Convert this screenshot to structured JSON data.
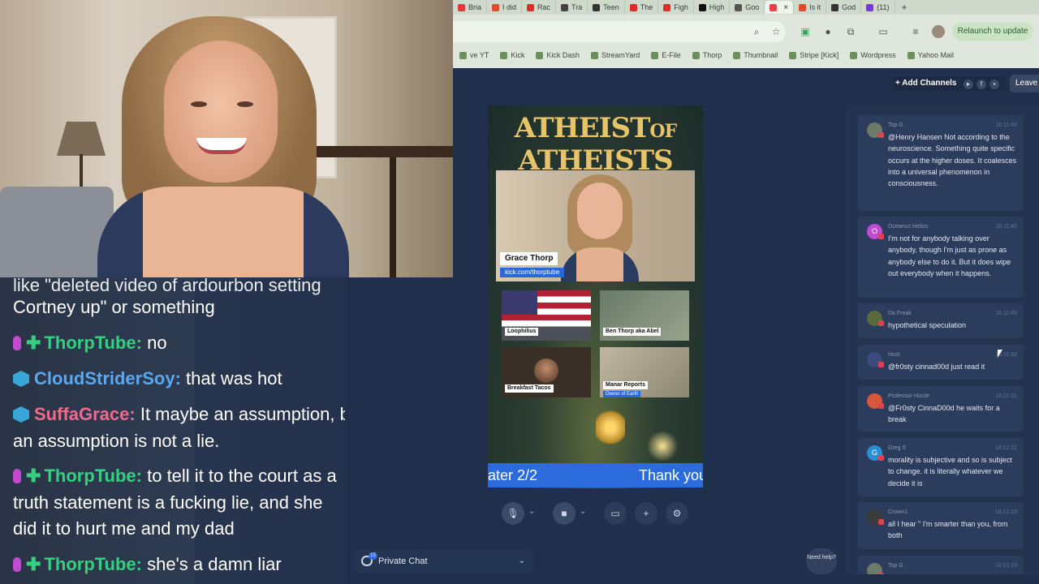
{
  "browser": {
    "tabs": [
      {
        "label": "Bria",
        "color": "#d93b3b"
      },
      {
        "label": "I did",
        "color": "#e34a2b"
      },
      {
        "label": "Rac",
        "color": "#e02b2b"
      },
      {
        "label": "Tra",
        "color": "#444444"
      },
      {
        "label": "Teen",
        "color": "#333333"
      },
      {
        "label": "The",
        "color": "#e02b2b"
      },
      {
        "label": "Figh",
        "color": "#e02b2b"
      },
      {
        "label": "High",
        "color": "#111111"
      },
      {
        "label": "Goo",
        "color": "#555555"
      },
      {
        "label": "",
        "color": "#e04646",
        "active": true
      },
      {
        "label": "Is it",
        "color": "#e34a2b"
      },
      {
        "label": "God",
        "color": "#333333"
      },
      {
        "label": "(11)",
        "color": "#7a3ad9"
      }
    ],
    "new_tab": "+",
    "relaunch_label": "Relaunch to update",
    "bookmarks": [
      "ve YT",
      "Kick",
      "Kick Dash",
      "StreamYard",
      "E-File",
      "Thorp",
      "Thumbnail",
      "Stripe [Kick]",
      "Wordpress",
      "Yahoo Mail"
    ]
  },
  "overlay_chat": {
    "lines": [
      {
        "type": "partial",
        "text": "like \"deleted video of ardourbon setting"
      },
      {
        "type": "cont",
        "text": "Cortney up\" or something"
      },
      {
        "type": "msg",
        "badge": "mod",
        "name": "ThorpTube:",
        "name_color": "#35d07f",
        "text": " no"
      },
      {
        "type": "msg",
        "badge": "cube",
        "name": "CloudStriderSoy:",
        "name_color": "#5aa8f0",
        "text": " that was hot"
      },
      {
        "type": "msg",
        "badge": "cube",
        "name": "SuffaGrace:",
        "name_color": "#f06a8a",
        "text": " It maybe an assumption, but"
      },
      {
        "type": "cont",
        "text": "an assumption is not a lie."
      },
      {
        "type": "msg",
        "badge": "mod",
        "name": "ThorpTube:",
        "name_color": "#35d07f",
        "text": " to tell it to the court as a"
      },
      {
        "type": "cont",
        "text": "truth statement is a fucking lie, and she"
      },
      {
        "type": "cont",
        "text": "did it to hurt me and my dad"
      },
      {
        "type": "msg",
        "badge": "mod",
        "name": "ThorpTube:",
        "name_color": "#35d07f",
        "text": " she's a damn liar"
      }
    ]
  },
  "studio": {
    "add_channels": "+ Add Channels",
    "leave": "Leave",
    "scene": {
      "title_line1_a": "ATHEIST",
      "title_line1_b": "OF",
      "title_line2": "ATHEISTS",
      "host_name": "Grace Thorp",
      "host_link": "kick.com/thorptube",
      "guests": [
        {
          "label": "Loophilius"
        },
        {
          "label": "Ben Thorp aka Abel"
        },
        {
          "label": "Breakfast Tacos"
        },
        {
          "label": "Manar Reports",
          "sub": "Owner of Earth"
        }
      ],
      "ticker_left": "ater 2/2",
      "ticker_right": "Thank you"
    },
    "private_chat": {
      "label": "Private Chat",
      "badge": "15"
    },
    "need_help": "Need help?"
  },
  "comments": [
    {
      "author": "Top G",
      "time": "18:11:40",
      "avatar_color": "#6d7a6a",
      "avatar_letter": "",
      "text": "@Henry Hansen Not according to the neuroscience. Something quite specific occurs at the higher doses. It coalesces into a universal phenomenon in consciousness."
    },
    {
      "author": "Oceanus Helios",
      "time": "18:11:40",
      "avatar_color": "#c04bd0",
      "avatar_letter": "O",
      "text": "I'm not for anybody talking over anybody, though I'm just as prone as anybody else to do it. But it does wipe out everybody when it happens."
    },
    {
      "author": "Da Freak",
      "time": "18:11:45",
      "avatar_color": "#5b6a3a",
      "avatar_letter": "",
      "text": "hypothetical speculation"
    },
    {
      "author": "Host",
      "time": "18:11:52",
      "avatar_color": "#3a4a7a",
      "avatar_letter": "",
      "text": "@fr0sty cinnad00d just read it"
    },
    {
      "author": "Professor Hizzle",
      "time": "18:11:51",
      "avatar_color": "#d9583c",
      "avatar_letter": "",
      "text": "@Fr0sty CinnaD00d he waits for a break"
    },
    {
      "author": "Greg S",
      "time": "18:12:22",
      "avatar_color": "#2a8fd0",
      "avatar_letter": "G",
      "text": "morality is subjective and so is subject to change. it is literally whatever we decide it is"
    },
    {
      "author": "Crown1",
      "time": "18:12:19",
      "avatar_color": "#3a3a3a",
      "avatar_letter": "",
      "text": "all I hear \" I'm smarter than you, from both"
    },
    {
      "author": "Top G",
      "time": "18:12:19",
      "avatar_color": "#6d7a6a",
      "avatar_letter": "",
      "text": ""
    }
  ]
}
